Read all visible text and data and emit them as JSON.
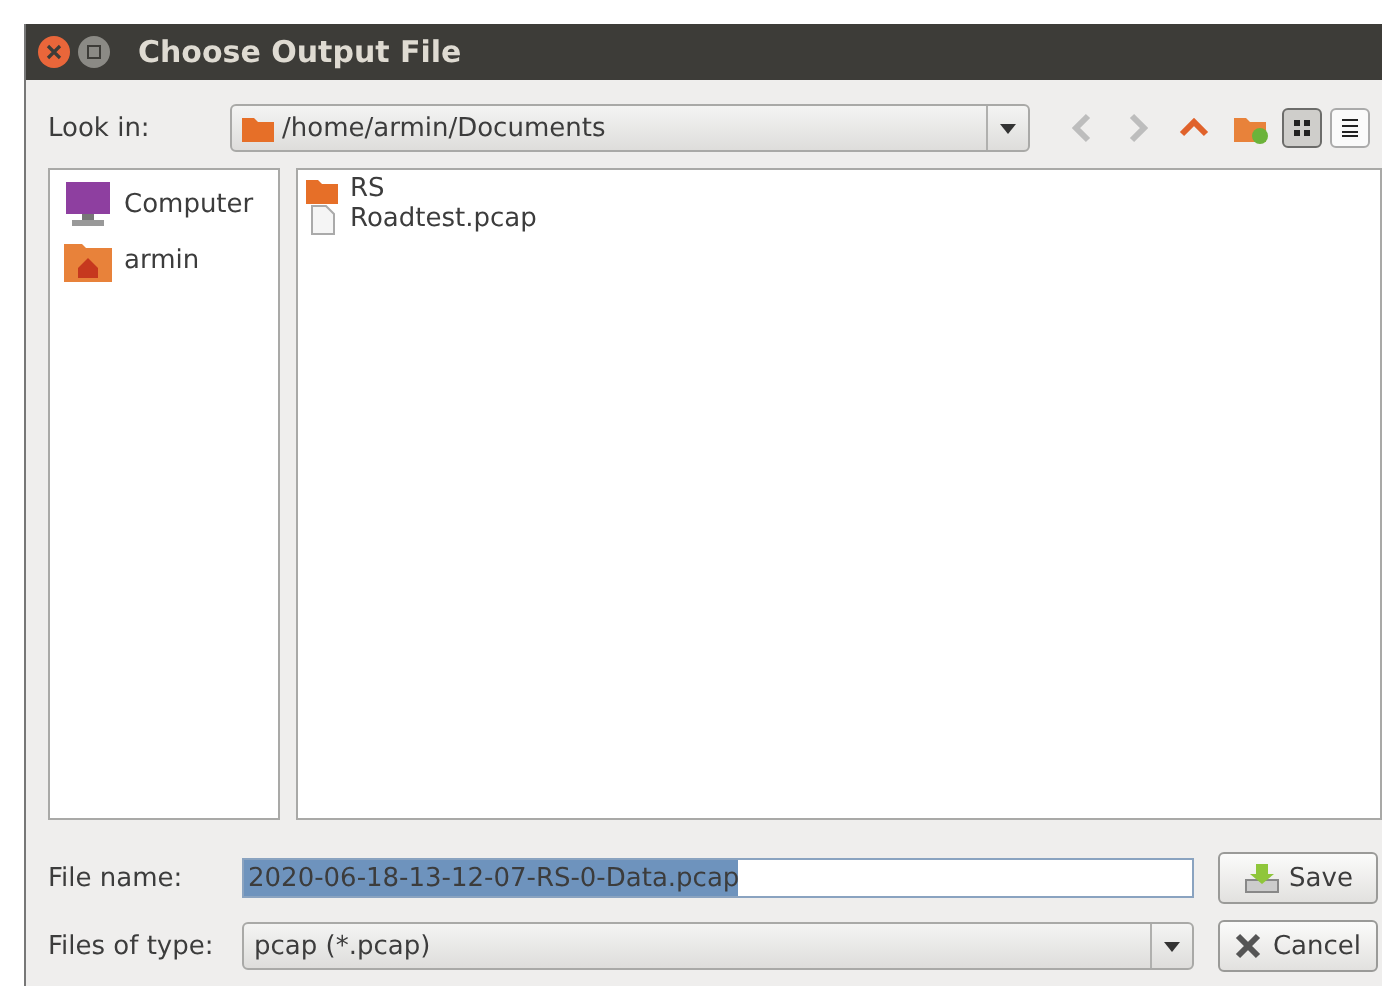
{
  "window": {
    "title": "Choose Output File"
  },
  "look_in": {
    "label": "Look in:",
    "path": "/home/armin/Documents"
  },
  "nav": [
    {
      "kind": "back",
      "disabled": true
    },
    {
      "kind": "forward",
      "disabled": true
    },
    {
      "kind": "up",
      "disabled": false
    },
    {
      "kind": "new-folder",
      "disabled": false
    }
  ],
  "view_modes": [
    {
      "kind": "icon",
      "selected": true
    },
    {
      "kind": "list",
      "selected": false
    }
  ],
  "sidebar": {
    "items": [
      {
        "kind": "computer",
        "label": "Computer"
      },
      {
        "kind": "home",
        "label": "armin"
      }
    ]
  },
  "files": [
    {
      "kind": "folder",
      "name": "RS"
    },
    {
      "kind": "file",
      "name": "Roadtest.pcap"
    }
  ],
  "file_name": {
    "label": "File name:",
    "value": "2020-06-18-13-12-07-RS-0-Data.pcap",
    "selected": true
  },
  "file_type": {
    "label": "Files of type:",
    "value": "pcap (*.pcap)"
  },
  "buttons": [
    {
      "kind": "save",
      "label": "Save"
    },
    {
      "kind": "cancel",
      "label": "Cancel"
    }
  ]
}
